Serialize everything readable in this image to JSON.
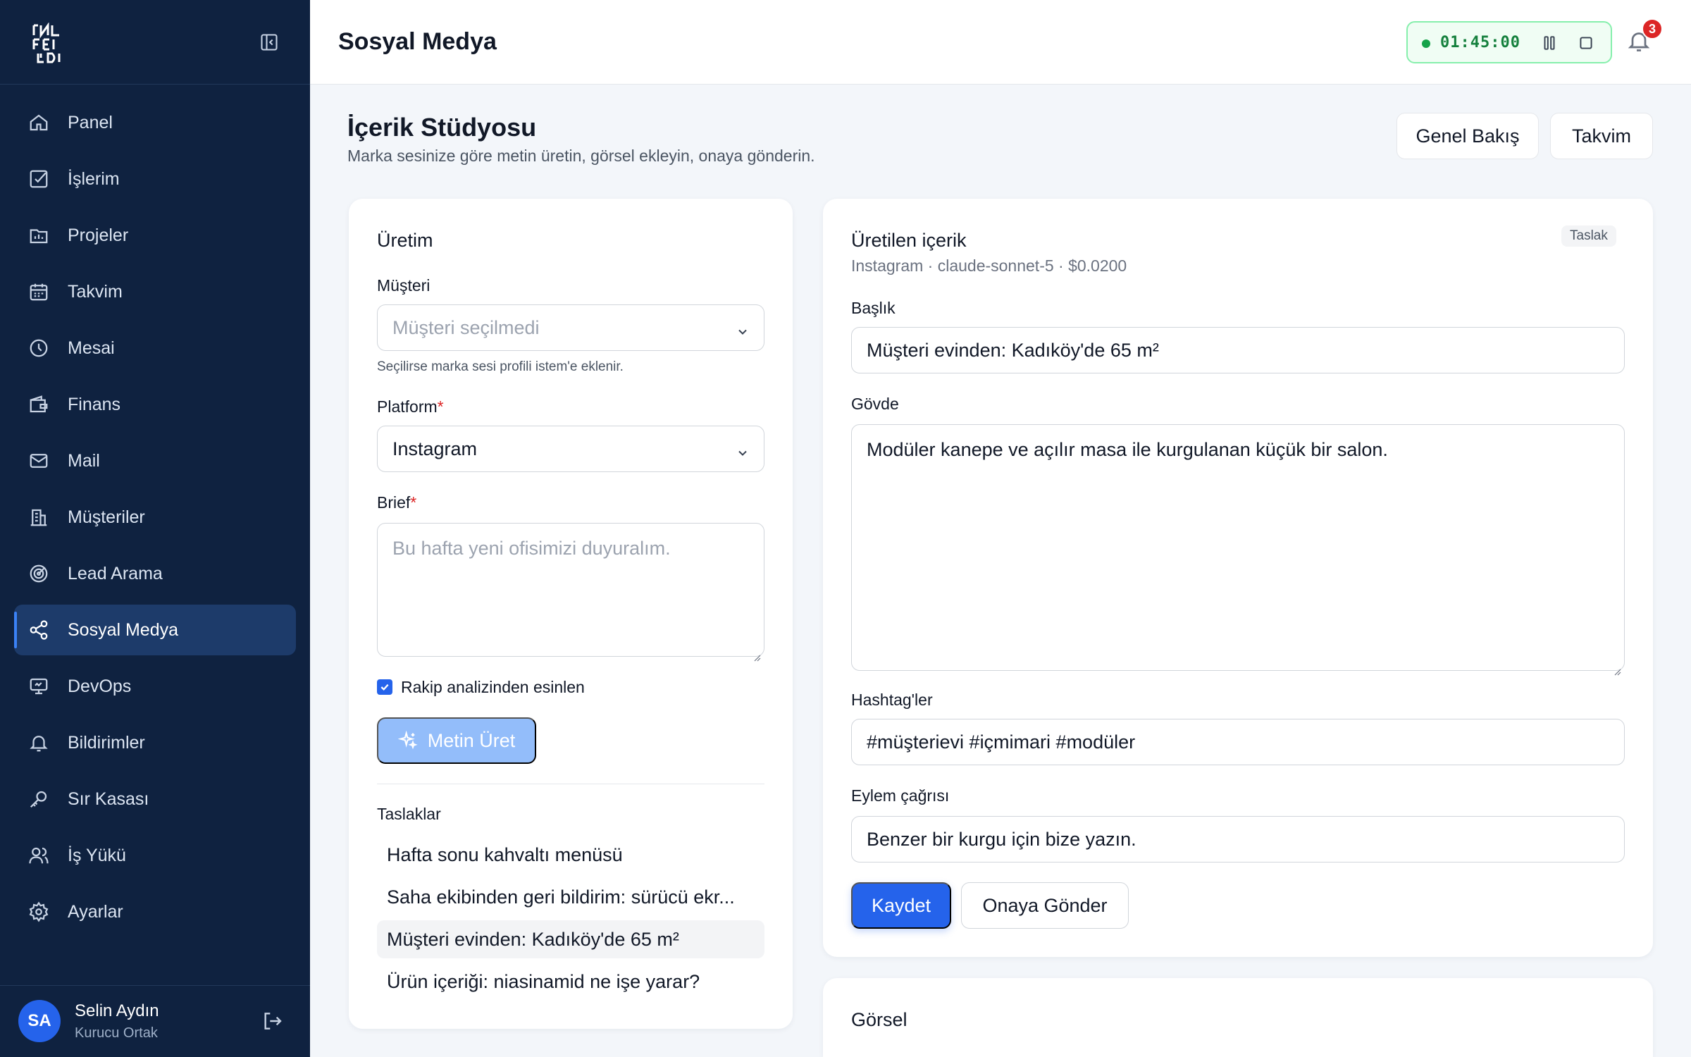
{
  "sidebar": {
    "logo_text": "INFEDI",
    "items": [
      {
        "label": "Panel",
        "icon": "home-icon"
      },
      {
        "label": "İşlerim",
        "icon": "checkbox-icon"
      },
      {
        "label": "Projeler",
        "icon": "project-icon"
      },
      {
        "label": "Takvim",
        "icon": "calendar-icon"
      },
      {
        "label": "Mesai",
        "icon": "clock-icon"
      },
      {
        "label": "Finans",
        "icon": "wallet-icon"
      },
      {
        "label": "Mail",
        "icon": "mail-icon"
      },
      {
        "label": "Müşteriler",
        "icon": "building-icon"
      },
      {
        "label": "Lead Arama",
        "icon": "radar-icon"
      },
      {
        "label": "Sosyal Medya",
        "icon": "share-icon",
        "active": true
      },
      {
        "label": "DevOps",
        "icon": "monitor-icon"
      },
      {
        "label": "Bildirimler",
        "icon": "bell-icon"
      },
      {
        "label": "Sır Kasası",
        "icon": "key-icon"
      },
      {
        "label": "İş Yükü",
        "icon": "users-icon"
      },
      {
        "label": "Ayarlar",
        "icon": "gear-icon"
      }
    ],
    "user": {
      "initials": "SA",
      "name": "Selin Aydın",
      "role": "Kurucu Ortak"
    }
  },
  "header": {
    "title": "Sosyal Medya",
    "timer": "01:45:00",
    "notification_count": "3"
  },
  "page": {
    "title": "İçerik Stüdyosu",
    "subtitle": "Marka sesinize göre metin üretin, görsel ekleyin, onaya gönderin.",
    "btn_overview": "Genel Bakış",
    "btn_calendar": "Takvim"
  },
  "production": {
    "title": "Üretim",
    "customer_label": "Müşteri",
    "customer_value": "Müşteri seçilmedi",
    "customer_hint": "Seçilirse marka sesi profili istem'e eklenir.",
    "platform_label": "Platform",
    "platform_value": "Instagram",
    "brief_label": "Brief",
    "brief_placeholder": "Bu hafta yeni ofisimizi duyuralım.",
    "required_mark": "*",
    "checkbox_label": "Rakip analizinden esinlen",
    "checkbox_checked": true,
    "generate_button": "Metin Üret",
    "drafts_title": "Taslaklar",
    "drafts": [
      {
        "title": "Hafta sonu kahvaltı menüsü"
      },
      {
        "title": "Saha ekibinden geri bildirim: sürücü ekr..."
      },
      {
        "title": "Müşteri evinden: Kadıköy'de 65 m²",
        "selected": true
      },
      {
        "title": "Ürün içeriği: niasinamid ne işe yarar?"
      }
    ]
  },
  "generated": {
    "title": "Üretilen içerik",
    "status_badge": "Taslak",
    "meta": "Instagram · claude-sonnet-5 · $0.0200",
    "heading_label": "Başlık",
    "heading_value": "Müşteri evinden: Kadıköy'de 65 m²",
    "body_label": "Gövde",
    "body_value": "Modüler kanepe ve açılır masa ile kurgulanan küçük bir salon.",
    "hashtags_label": "Hashtag'ler",
    "hashtags_value": "#müşterievi #içmimari #modüler",
    "cta_label": "Eylem çağrısı",
    "cta_value": "Benzer bir kurgu için bize yazın.",
    "save_button": "Kaydet",
    "send_button": "Onaya Gönder"
  },
  "visual": {
    "title": "Görsel"
  },
  "colors": {
    "sidebar_bg": "#0f2240",
    "sidebar_active": "#1d3b6a",
    "accent": "#2563eb",
    "timer_green": "#16a34a",
    "required_red": "#dc2626"
  }
}
